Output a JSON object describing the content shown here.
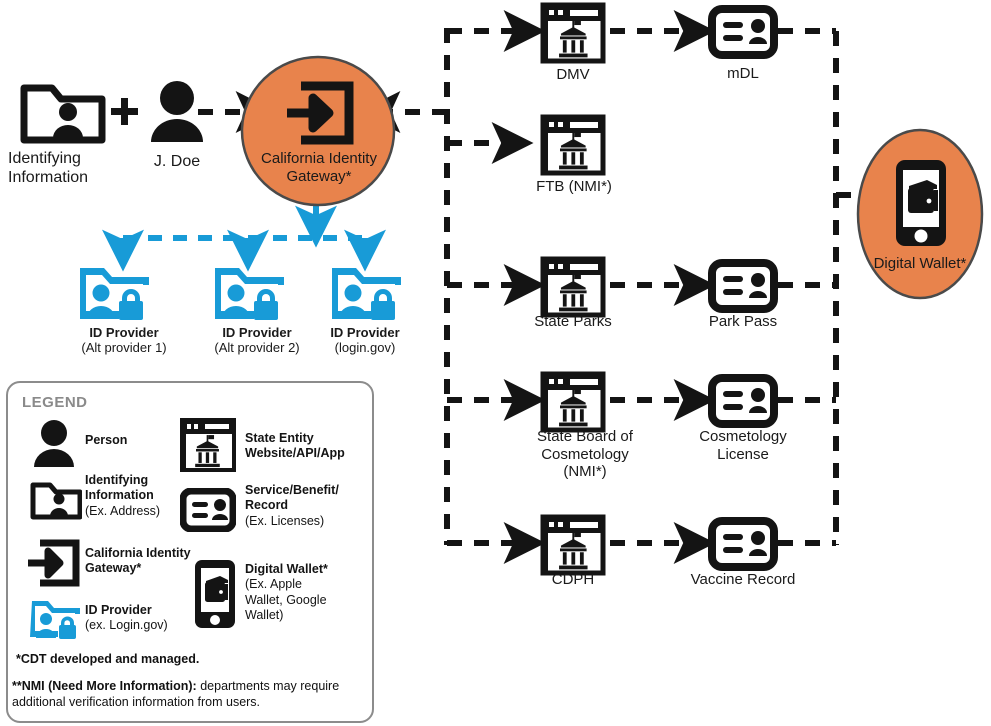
{
  "diagram": {
    "title": "California Identity Gateway flow",
    "colors": {
      "orange": "#E8834C",
      "orange_stroke": "#4a4a4a",
      "blue": "#189BD7",
      "black": "#141414",
      "legend_border": "#8c8c8c",
      "legend_title": "#8a8a8a"
    }
  },
  "left": {
    "identifying_information": {
      "line1": "Identifying",
      "line2": "Information",
      "icon": "identifying-information-icon"
    },
    "plus": "+",
    "person": {
      "label": "J. Doe",
      "icon": "person-icon"
    },
    "gateway": {
      "line1": "California Identity",
      "line2": "Gateway*",
      "icon": "identity-gateway-icon"
    }
  },
  "id_providers": [
    {
      "label": "ID Provider",
      "sub": "(Alt provider 1)",
      "icon": "id-provider-icon"
    },
    {
      "label": "ID Provider",
      "sub": "(Alt provider 2)",
      "icon": "id-provider-icon"
    },
    {
      "label": "ID Provider",
      "sub": "(login.gov)",
      "icon": "id-provider-icon"
    }
  ],
  "agencies": [
    {
      "name": "DMV",
      "icon": "state-entity-website-icon"
    },
    {
      "name": "FTB  (NMI*)",
      "icon": "state-entity-website-icon"
    },
    {
      "name": "State Parks",
      "icon": "state-entity-website-icon"
    },
    {
      "name": "State Board of\nCosmetology\n(NMI*)",
      "icon": "state-entity-website-icon"
    },
    {
      "name": "CDPH",
      "icon": "state-entity-website-icon"
    }
  ],
  "records": [
    {
      "name": "mDL",
      "icon": "service-record-icon"
    },
    {
      "name": "Park Pass",
      "icon": "service-record-icon"
    },
    {
      "name": "Cosmetology\nLicense",
      "icon": "service-record-icon"
    },
    {
      "name": "Vaccine Record",
      "icon": "service-record-icon"
    }
  ],
  "wallet": {
    "label": "Digital Wallet*",
    "icon": "digital-wallet-icon"
  },
  "legend": {
    "title": "LEGEND",
    "items_left": [
      {
        "label": "Person",
        "sub": "",
        "icon": "person-icon"
      },
      {
        "label": "Identifying\nInformation",
        "sub": "(Ex. Address)",
        "icon": "identifying-information-icon"
      },
      {
        "label": "California Identity\nGateway*",
        "sub": "",
        "icon": "identity-gateway-icon"
      },
      {
        "label": "ID Provider",
        "sub": "(ex. Login.gov)",
        "icon": "id-provider-icon"
      }
    ],
    "items_right": [
      {
        "label": "State Entity\nWebsite/API/App",
        "sub": "",
        "icon": "state-entity-website-icon"
      },
      {
        "label": "Service/Benefit/\nRecord",
        "sub": "(Ex. Licenses)",
        "icon": "service-record-icon"
      },
      {
        "label": "Digital Wallet*",
        "sub": "(Ex. Apple\nWallet, Google\nWallet)",
        "icon": "digital-wallet-icon"
      }
    ],
    "footnote1": "*CDT developed and managed.",
    "footnote2_bold": "**NMI (Need More Information):",
    "footnote2_rest": " departments may require additional verification information from users."
  }
}
